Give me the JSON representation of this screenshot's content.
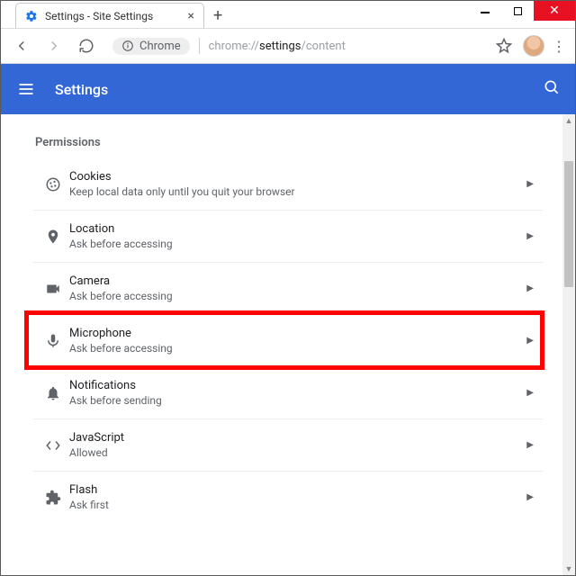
{
  "window": {
    "tab_title": "Settings - Site Settings"
  },
  "omnibox": {
    "scheme_label": "Chrome",
    "url_muted_prefix": "chrome://",
    "url_strong": "settings",
    "url_muted_suffix": "/content"
  },
  "toolbar": {
    "app_title": "Settings"
  },
  "section": {
    "title": "Permissions"
  },
  "permissions": [
    {
      "name": "Cookies",
      "desc": "Keep local data only until you quit your browser"
    },
    {
      "name": "Location",
      "desc": "Ask before accessing"
    },
    {
      "name": "Camera",
      "desc": "Ask before accessing"
    },
    {
      "name": "Microphone",
      "desc": "Ask before accessing"
    },
    {
      "name": "Notifications",
      "desc": "Ask before sending"
    },
    {
      "name": "JavaScript",
      "desc": "Allowed"
    },
    {
      "name": "Flash",
      "desc": "Ask first"
    }
  ],
  "highlight_index": 3
}
